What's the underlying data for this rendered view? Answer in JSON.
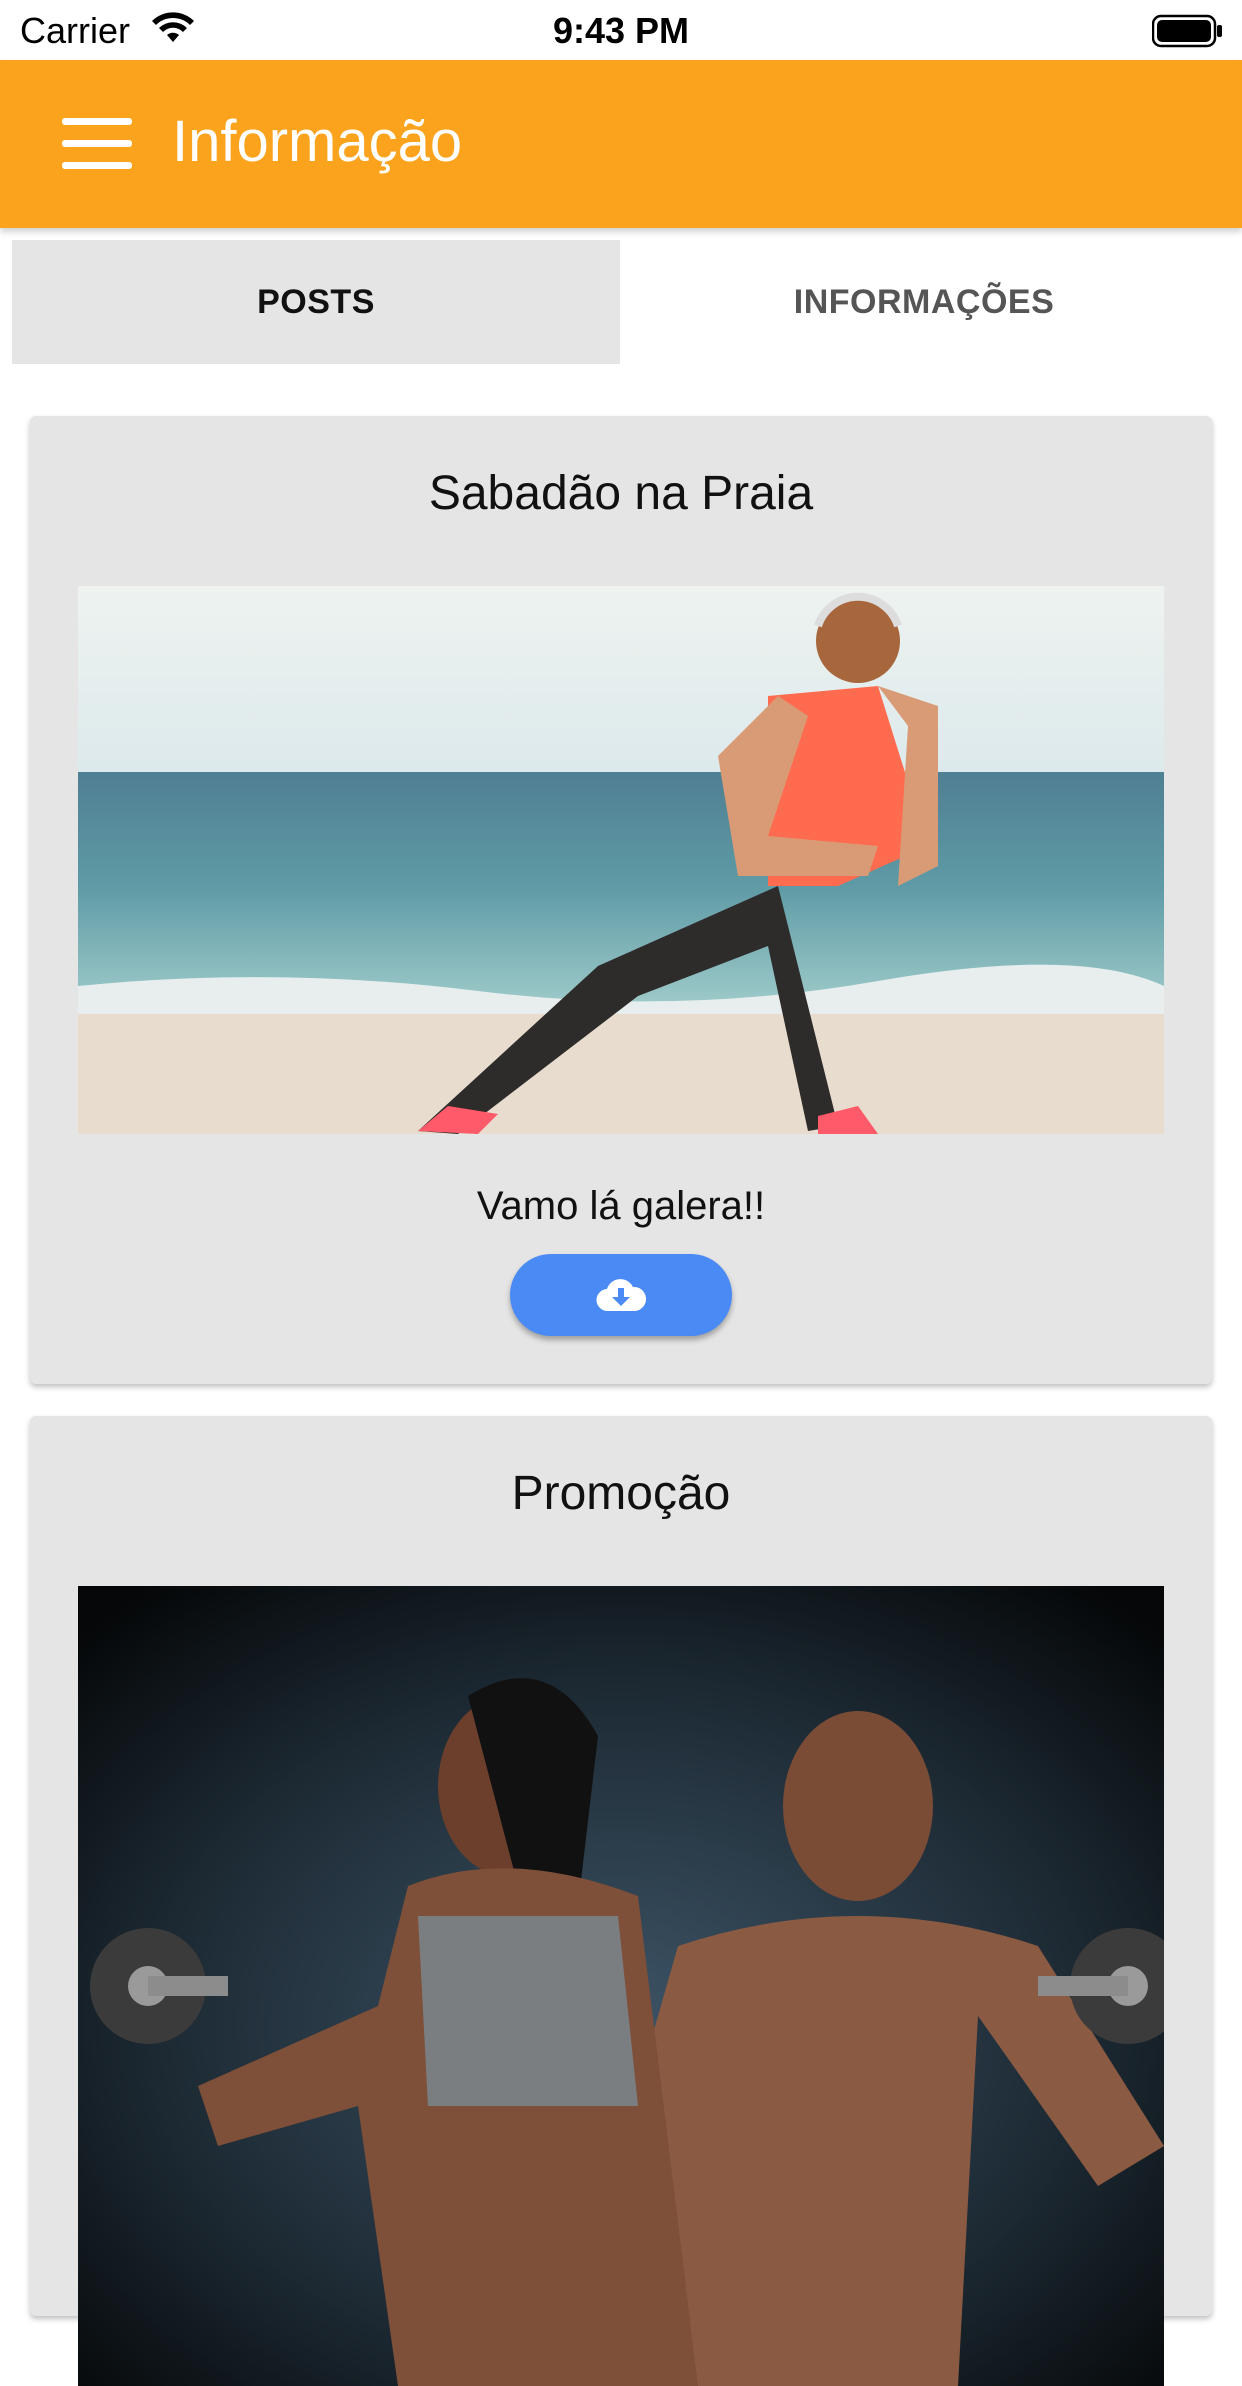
{
  "status_bar": {
    "carrier": "Carrier",
    "time": "9:43 PM",
    "icons": [
      "wifi-icon",
      "battery-icon"
    ]
  },
  "app_bar": {
    "title": "Informação",
    "menu_icon": "menu-icon",
    "color": "#fca31d"
  },
  "tabs": [
    {
      "label": "POSTS",
      "active": true
    },
    {
      "label": "INFORMAÇÕES",
      "active": false
    }
  ],
  "posts": [
    {
      "title": "Sabadão na Praia",
      "image": "beach-stretching-photo",
      "text": "Vamo lá galera!!",
      "button_icon": "cloud-download-icon"
    },
    {
      "title": "Promoção",
      "image": "gym-couple-dumbbells-photo"
    }
  ],
  "colors": {
    "accent": "#fca31d",
    "button": "#4a8af4",
    "card": "#e5e5e5"
  }
}
